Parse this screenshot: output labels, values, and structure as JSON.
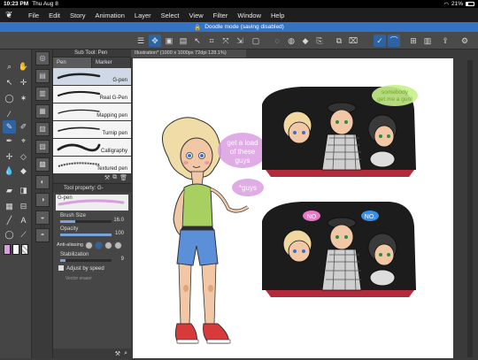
{
  "statusbar": {
    "time": "10:23 PM",
    "date": "Thu Aug 8",
    "battery": "21%"
  },
  "menu": [
    "File",
    "Edit",
    "Story",
    "Animation",
    "Layer",
    "Select",
    "View",
    "Filter",
    "Window",
    "Help"
  ],
  "doodle_mode": "Doodle mode (saving disabled)",
  "subtool": {
    "title": "Sub Tool: Pen",
    "tabs": [
      "Pen",
      "Marker"
    ],
    "brushes": [
      "G-pen",
      "Real G-Pen",
      "Mapping pen",
      "Turnip pen",
      "Calligraphy",
      "Textured pen"
    ]
  },
  "toolprop": {
    "title": "Tool property: G-",
    "current": "G-pen",
    "brush_size_label": "Brush Size",
    "brush_size": "16.0",
    "brush_size_frac": 0.3,
    "opacity_label": "Opacity",
    "opacity": "100",
    "opacity_frac": 1.0,
    "antialias_label": "Anti-aliasing",
    "stabilization_label": "Stabilization",
    "stabilization": "9",
    "stabilization_frac": 0.1,
    "adjust_label": "Adjust by speed",
    "vector_label": "Vector eraser"
  },
  "canvas": {
    "tab": "Illustration* (1000 x 1000px 72dpi 128.1%)",
    "texts": [
      "get a load",
      "of these",
      "guys",
      "*guys",
      "somebody",
      "get me a gun!",
      "NO",
      "NO."
    ]
  },
  "colors": {
    "accent": "#2e63a3",
    "doodle_bar": "#3472c4",
    "pink": "#d99ee0",
    "lime": "#c8f08a"
  }
}
